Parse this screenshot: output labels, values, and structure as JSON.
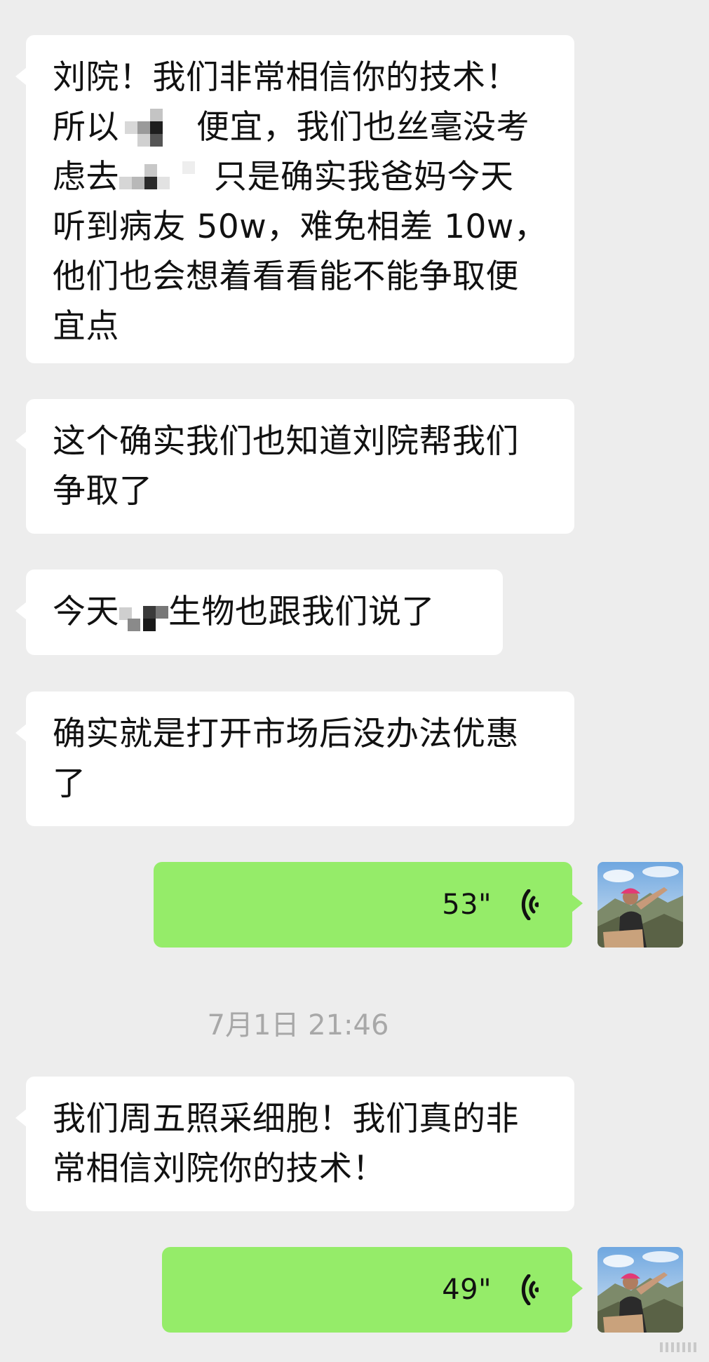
{
  "chat": {
    "messages": [
      {
        "direction": "incoming",
        "lines": [
          "刘院！我们非常相信你的技术！",
          "所以",
          "便宜，我们也丝毫没考",
          "虑去",
          "只是确实我爸妈今天",
          "听到病友 50w，难免相差 10w，",
          "他们也会想着看看能不能争取便",
          "宜点"
        ]
      },
      {
        "direction": "incoming",
        "lines": [
          "这个确实我们也知道刘院帮我们",
          "争取了"
        ]
      },
      {
        "direction": "incoming",
        "lines": [
          "今天",
          "生物也跟我们说了"
        ]
      },
      {
        "direction": "incoming",
        "lines": [
          "确实就是打开市场后没办法优惠",
          "了"
        ]
      },
      {
        "direction": "outgoing",
        "type": "voice",
        "duration": "53\""
      },
      {
        "type": "timestamp",
        "text": "7月1日 21:46"
      },
      {
        "direction": "incoming",
        "lines": [
          "我们周五照采细胞！我们真的非",
          "常相信刘院你的技术！"
        ]
      },
      {
        "direction": "outgoing",
        "type": "voice",
        "duration": "49\""
      }
    ]
  },
  "colors": {
    "background": "#ededed",
    "incoming_bubble": "#ffffff",
    "outgoing_bubble": "#95ec69",
    "timestamp_text": "#a8a8a8"
  },
  "icons": {
    "voice": "voice-wave-icon",
    "avatar": "user-avatar",
    "redaction": "mosaic-redaction",
    "watermark": "watermark-logo"
  }
}
